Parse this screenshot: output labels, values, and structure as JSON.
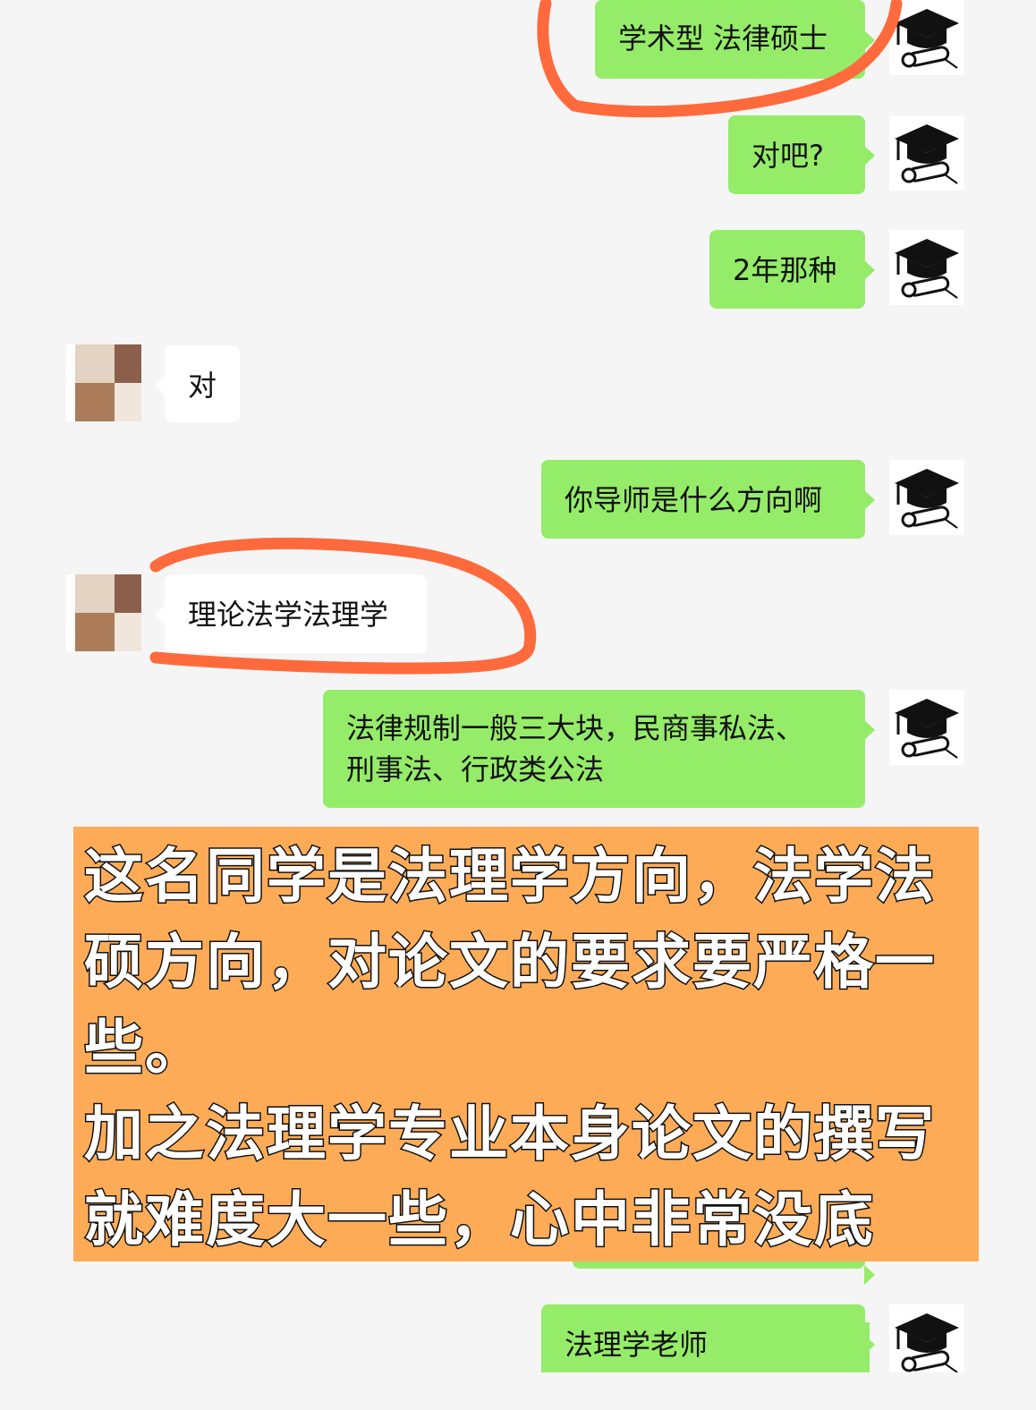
{
  "messages": [
    {
      "side": "me",
      "text": "学术型 法律硕士"
    },
    {
      "side": "me",
      "text": "对吧?"
    },
    {
      "side": "me",
      "text": "2年那种"
    },
    {
      "side": "them",
      "text": "对"
    },
    {
      "side": "me",
      "text": "你导师是什么方向啊"
    },
    {
      "side": "them",
      "text": "理论法学法理学"
    },
    {
      "side": "me",
      "line1": "法律规制一般三大块，民商事私法、",
      "line2": "刑事法、行政类公法"
    },
    {
      "side": "me",
      "text": "法理学老师"
    }
  ],
  "overlay": {
    "lines": [
      "这名同学是法理学方向，法学法",
      "硕方向，对论文的要求要严格一",
      "些。",
      "加之法理学专业本身论文的撰写",
      "就难度大一些，心中非常没底"
    ],
    "background": "#feab57"
  },
  "colors": {
    "my_bubble": "#95ec69",
    "their_bubble": "#ffffff",
    "annotation": "#ff6a3d",
    "background": "#f5f5f5"
  },
  "icons": {
    "my_avatar": "graduation-cap-icon",
    "their_avatar": "user-photo-avatar"
  }
}
